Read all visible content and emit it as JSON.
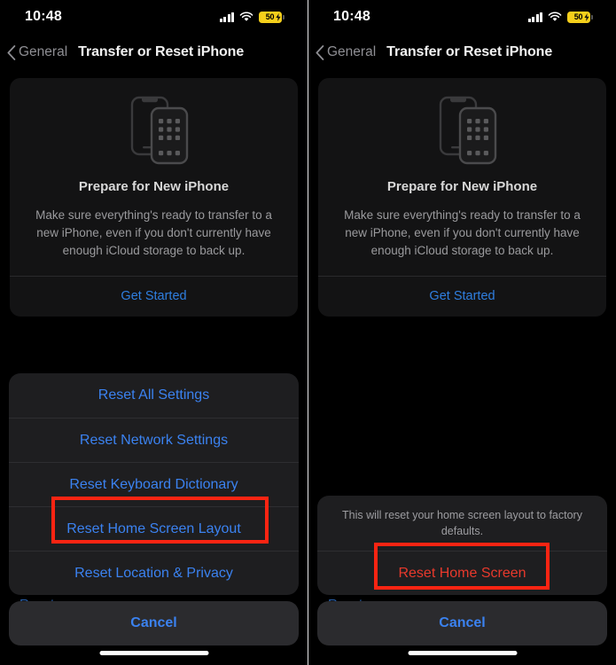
{
  "meta": {
    "accent_blue": "#3b82f0",
    "destructive_red": "#e8392c",
    "annotation_red": "#fb2412",
    "battery_yellow": "#f5cf1b"
  },
  "status_bar": {
    "time": "10:48",
    "cellular_icon": "cellular-bars-icon",
    "wifi_icon": "wifi-icon",
    "battery_icon": "battery-charging-icon",
    "battery_percent": "50"
  },
  "nav": {
    "back_icon": "chevron-left-icon",
    "back_label": "General",
    "title": "Transfer or Reset iPhone"
  },
  "card": {
    "icon": "two-iphones-icon",
    "title": "Prepare for New iPhone",
    "body": "Make sure everything's ready to transfer to a new iPhone, even if you don't currently have enough iCloud storage to back up.",
    "action_label": "Get Started"
  },
  "left_panel": {
    "ghost_row_label": "Reset",
    "sheet_rows": [
      {
        "label": "Reset All Settings",
        "style": "default"
      },
      {
        "label": "Reset Network Settings",
        "style": "default"
      },
      {
        "label": "Reset Keyboard Dictionary",
        "style": "default"
      },
      {
        "label": "Reset Home Screen Layout",
        "style": "default"
      },
      {
        "label": "Reset Location & Privacy",
        "style": "default"
      }
    ],
    "cancel_label": "Cancel",
    "highlight_target": "Reset Home Screen Layout"
  },
  "right_panel": {
    "ghost_row_label": "Reset",
    "alert_message": "This will reset your home screen layout to factory defaults.",
    "confirm_label": "Reset Home Screen",
    "cancel_label": "Cancel",
    "highlight_target": "Reset Home Screen"
  }
}
